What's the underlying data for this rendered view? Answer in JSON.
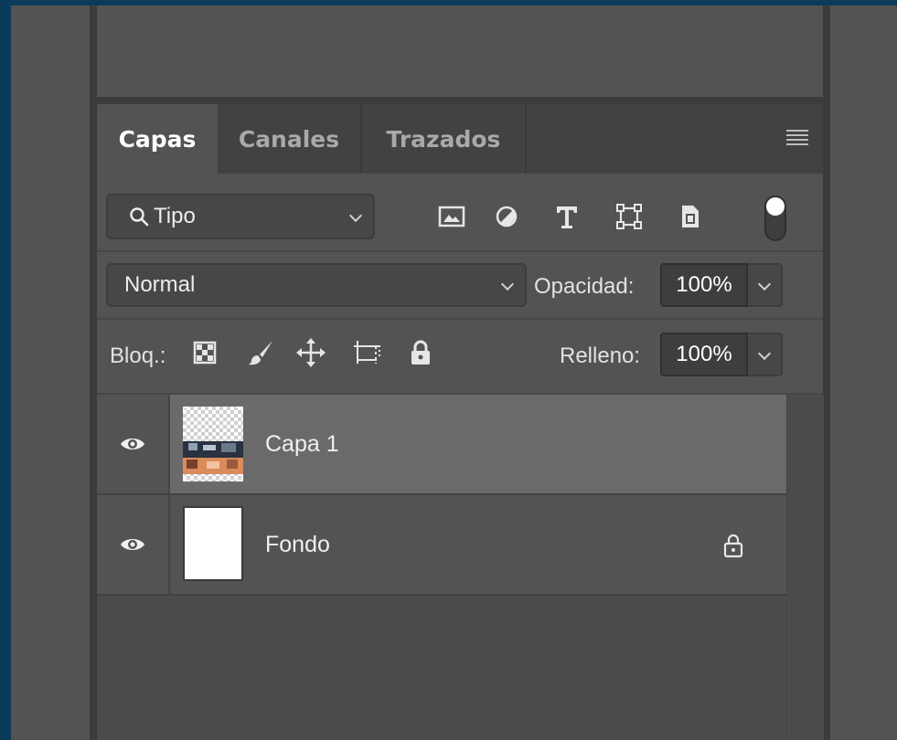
{
  "tabs": [
    {
      "label": "Capas",
      "active": true
    },
    {
      "label": "Canales",
      "active": false
    },
    {
      "label": "Trazados",
      "active": false
    }
  ],
  "filter": {
    "selected": "Tipo",
    "icons": [
      "image-filter-icon",
      "adjustment-filter-icon",
      "type-filter-icon",
      "shape-filter-icon",
      "smart-object-filter-icon"
    ]
  },
  "blend": {
    "mode": "Normal",
    "opacity_label": "Opacidad:",
    "opacity_value": "100%"
  },
  "lock": {
    "label": "Bloq.:",
    "icons": [
      "lock-transparent-pixels-icon",
      "lock-image-pixels-icon",
      "lock-position-icon",
      "lock-artboard-icon",
      "lock-all-icon"
    ],
    "fill_label": "Relleno:",
    "fill_value": "100%"
  },
  "layers": [
    {
      "name": "Capa 1",
      "visible": true,
      "selected": true,
      "locked": false
    },
    {
      "name": "Fondo",
      "visible": true,
      "selected": false,
      "locked": true
    }
  ],
  "colors": {
    "background": "#0b3b5a",
    "panel": "#535353",
    "selected_layer": "#6a6a6a",
    "field": "#3e3e3e"
  }
}
